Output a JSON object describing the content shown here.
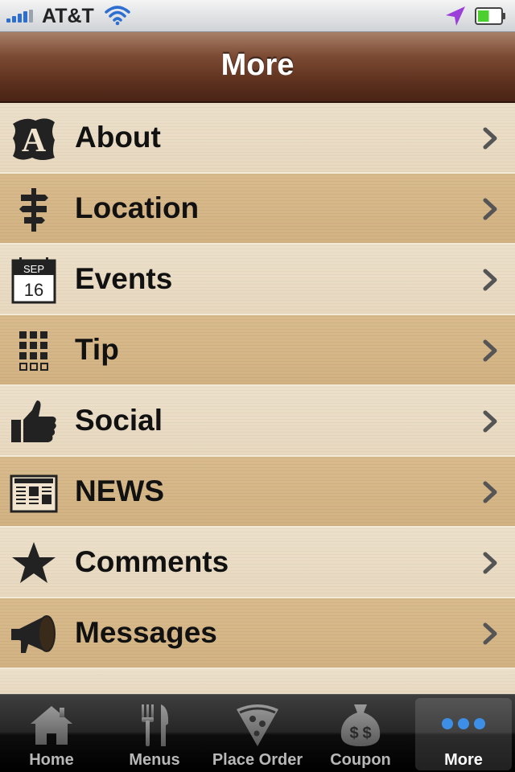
{
  "status_bar": {
    "carrier": "AT&T",
    "signal_bars": 5,
    "wifi_icon": "wifi-icon",
    "location_icon": "location-arrow-icon",
    "battery_level": 0.5,
    "battery_color": "#4cd030"
  },
  "nav": {
    "title": "More",
    "color": "#5a2f1d"
  },
  "menu": {
    "items": [
      {
        "label": "About",
        "icon": "about-letter-icon"
      },
      {
        "label": "Location",
        "icon": "signpost-icon"
      },
      {
        "label": "Events",
        "icon": "calendar-icon",
        "calendar_month": "SEP",
        "calendar_day": "16"
      },
      {
        "label": "Tip",
        "icon": "keypad-icon"
      },
      {
        "label": "Social",
        "icon": "thumbs-up-icon"
      },
      {
        "label": "NEWS",
        "icon": "newspaper-icon"
      },
      {
        "label": "Comments",
        "icon": "star-icon"
      },
      {
        "label": "Messages",
        "icon": "megaphone-icon"
      }
    ],
    "chevron_icon": "chevron-right-icon"
  },
  "tab_bar": {
    "tabs": [
      {
        "label": "Home",
        "icon": "home-icon",
        "active": false
      },
      {
        "label": "Menus",
        "icon": "fork-knife-icon",
        "active": false
      },
      {
        "label": "Place Order",
        "icon": "pizza-icon",
        "active": false
      },
      {
        "label": "Coupon",
        "icon": "money-bag-icon",
        "active": false
      },
      {
        "label": "More",
        "icon": "more-dots-icon",
        "active": true
      }
    ],
    "active_dot_color": "#3d8ee6"
  }
}
